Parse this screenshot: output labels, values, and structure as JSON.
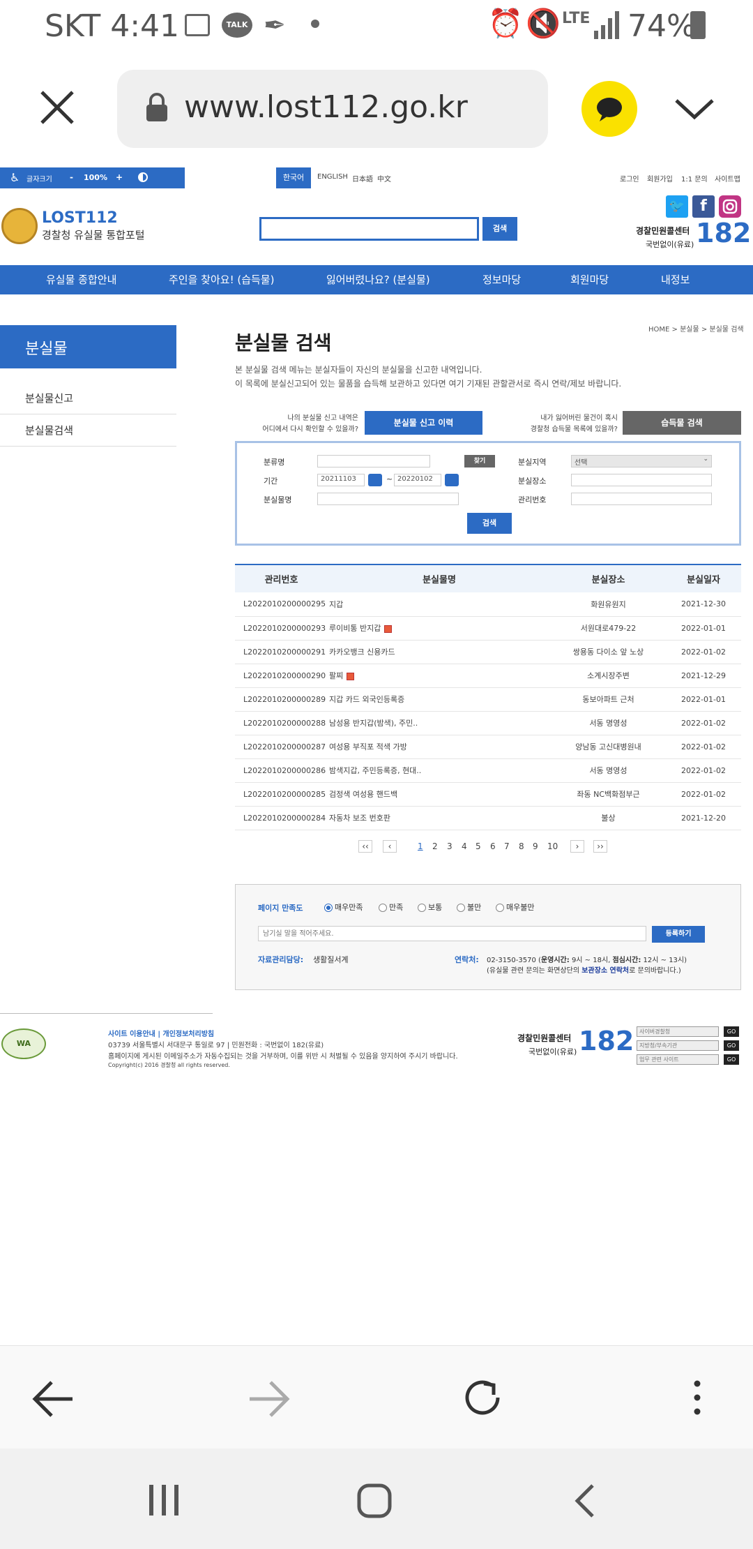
{
  "status_bar": {
    "carrier_time": "SKT 4:41",
    "talk_label": "TALK",
    "network": "LTE",
    "battery": "74%"
  },
  "browser": {
    "url": "www.lost112.go.kr"
  },
  "site": {
    "top": {
      "font_size_label": "글자크기",
      "zoom_minus": "-",
      "zoom_value": "100%",
      "zoom_plus": "+",
      "languages": [
        "한국어",
        "ENGLISH",
        "日本語",
        "中文"
      ],
      "links": [
        "로그인",
        "회원가입",
        "1:1 문의",
        "사이트맵"
      ]
    },
    "header": {
      "logo_title": "LOST112",
      "logo_subtitle": "경찰청 유실물 통합포털",
      "search_button": "검색",
      "call_center_line1": "경찰민원콜센터",
      "call_center_line2": "국번없이(유료)",
      "call_center_number": "182"
    },
    "nav": [
      "유실물 종합안내",
      "주인을 찾아요! (습득물)",
      "잃어버렸나요? (분실물)",
      "정보마당",
      "회원마당",
      "내정보"
    ],
    "sidebar": {
      "title": "분실물",
      "items": [
        "분실물신고",
        "분실물검색"
      ]
    },
    "breadcrumb": "HOME > 분실물 > 분실물 검색",
    "page_title": "분실물 검색",
    "description_1": "본 분실물 검색 메뉴는 분실자들이 자신의 분실물을 신고한 내역입니다.",
    "description_2": "이 목록에 분실신고되어 있는 물품을 습득해 보관하고 있다면 여기 기재된 관할관서로 즉시 연락/제보 바랍니다.",
    "quick": {
      "left_q1": "나의 분실물 신고 내역은",
      "left_q2": "어디에서 다시 확인할 수 있을까?",
      "left_button": "분실물 신고 이력",
      "right_q1": "내가 잃어버린 물건이 혹시",
      "right_q2": "경찰청 습득물 목록에 있을까?",
      "right_button": "습득물 검색"
    },
    "search_form": {
      "category_label": "분류명",
      "find_button": "찾기",
      "period_label": "기간",
      "date_from": "20211103",
      "date_sep": "~",
      "date_to": "20220102",
      "item_label": "분실물명",
      "region_label": "분실지역",
      "region_value": "선택",
      "place_label": "분실장소",
      "id_label": "관리번호",
      "search_button": "검색"
    },
    "table": {
      "headers": [
        "관리번호",
        "분실물명",
        "분실장소",
        "분실일자"
      ],
      "rows": [
        [
          "L2022010200000295",
          "지갑",
          "화원유원지",
          "2021-12-30"
        ],
        [
          "L2022010200000293",
          "루이비통 반지갑",
          "서원대로479-22",
          "2022-01-01"
        ],
        [
          "L2022010200000291",
          "카카오뱅크 신용카드",
          "쌍용동 다이소 앞 노상",
          "2022-01-02"
        ],
        [
          "L2022010200000290",
          "팔찌",
          "소계시장주변",
          "2021-12-29"
        ],
        [
          "L2022010200000289",
          "지갑 카드 외국인등록증",
          "동보아파트 근처",
          "2022-01-01"
        ],
        [
          "L2022010200000288",
          "남성용 반지갑(밤색), 주민..",
          "서동 명영성",
          "2022-01-02"
        ],
        [
          "L2022010200000287",
          "여성용 부직포 적색 가방",
          "양남동 고신대병원내",
          "2022-01-02"
        ],
        [
          "L2022010200000286",
          "밤색지갑, 주민등록증, 현대..",
          "서동 명영성",
          "2022-01-02"
        ],
        [
          "L2022010200000285",
          "검정색 여성용 핸드백",
          "좌동 NC백화점부근",
          "2022-01-02"
        ],
        [
          "L2022010200000284",
          "자동차 보조 번호판",
          "불상",
          "2021-12-20"
        ]
      ]
    },
    "pagination": {
      "first": "‹‹",
      "prev": "‹",
      "pages": [
        "1",
        "2",
        "3",
        "4",
        "5",
        "6",
        "7",
        "8",
        "9",
        "10"
      ],
      "next": "›",
      "last": "››",
      "current": "1"
    },
    "survey": {
      "label": "페이지 만족도",
      "options": [
        "매우만족",
        "만족",
        "보통",
        "불만",
        "매우불만"
      ],
      "placeholder": "남기실 말을 적어주세요.",
      "submit": "등록하기",
      "manager_label": "자료관리담당:",
      "manager_value": "생활질서계",
      "contact_label": "연락처:",
      "contact_number": "02-3150-3570",
      "hours_label": "운영시간:",
      "hours_value": "9시 ~ 18시,",
      "lunch_label": "점심시간:",
      "lunch_value": "12시 ~ 13시)",
      "note_1": "(유실물 관련 문의는 화면상단의",
      "note_link": "보관장소 연락처",
      "note_2": "로 문의바랍니다.)"
    },
    "footer": {
      "links": "사이트 이용안내 | 개인정보처리방침",
      "address": "03739 서울특별시 서대문구 통일로 97 | 민원전화 : 국번없이 182(유료)",
      "notice": "홈페이지에 게시된 이메일주소가 자동수집되는 것을 거부하며, 이를 위반 시 처벌될 수 있음을 양지하여 주시기 바랍니다.",
      "copyright": "Copyright(c) 2016 경찰청 all rights reserved.",
      "call_center_line1": "경찰민원콜센터",
      "call_center_line2": "국번없이(유료)",
      "call_center_number": "182",
      "selects": [
        "사이버경찰청",
        "지방청/부속기관",
        "업무 관련 사이트"
      ],
      "go": "GO"
    }
  },
  "colors": {
    "primary": "#2c6bc4",
    "kakao_yellow": "#fae100"
  }
}
